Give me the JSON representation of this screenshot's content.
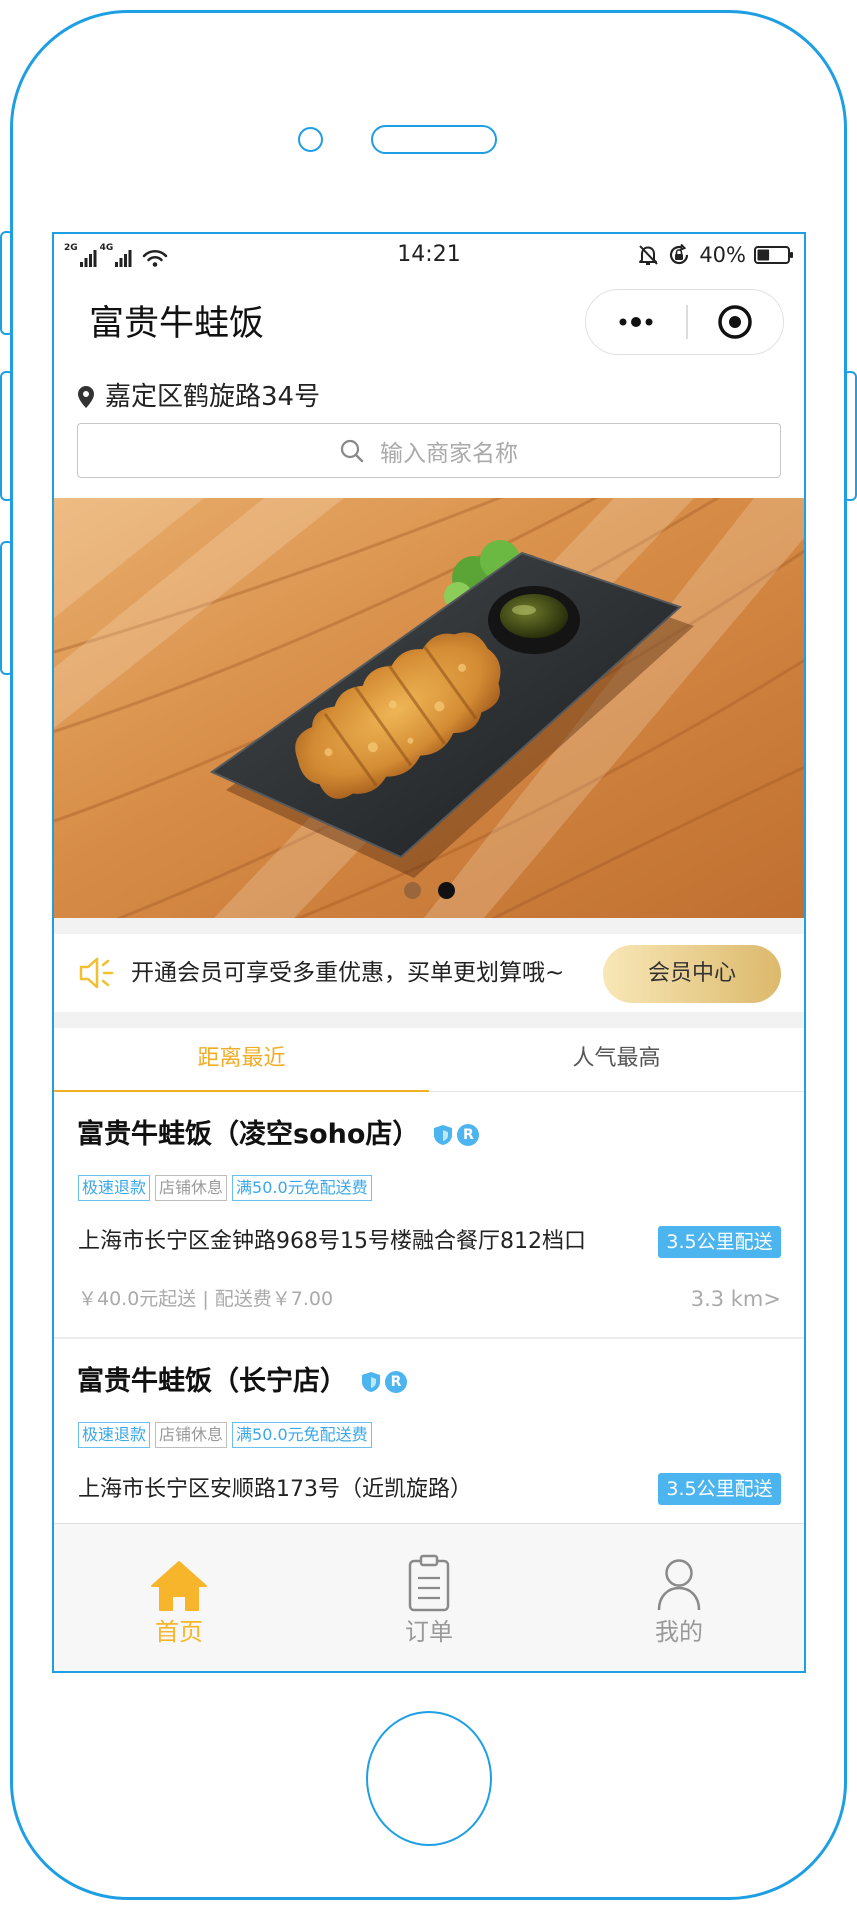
{
  "status_bar": {
    "network_1": "2G",
    "network_2": "4G",
    "time": "14:21",
    "battery_text": "40%",
    "battery_level": 0.4,
    "icons": [
      "signal-icon",
      "wifi-icon",
      "bell-off-icon",
      "rotation-lock-icon",
      "battery-icon"
    ]
  },
  "header": {
    "title": "富贵牛蛙饭",
    "capsule_icons": [
      "more-dots-icon",
      "target-icon"
    ]
  },
  "location": {
    "icon": "location-pin-icon",
    "text": "嘉定区鹤旋路34号"
  },
  "search": {
    "icon": "search-icon",
    "placeholder": "输入商家名称"
  },
  "banner": {
    "slide_count": 2,
    "active_slide": 2
  },
  "member": {
    "icon": "speaker-icon",
    "text": "开通会员可享受多重优惠，买单更划算哦~",
    "button": "会员中心"
  },
  "sort_tabs": [
    {
      "label": "距离最近",
      "active": true
    },
    {
      "label": "人气最高",
      "active": false
    }
  ],
  "stores": [
    {
      "name": "富贵牛蛙饭（凌空soho店）",
      "badges": [
        {
          "icon": "shield-icon"
        },
        {
          "icon": "registered-icon",
          "label": "R"
        }
      ],
      "tags": [
        {
          "label": "极速退款",
          "color": "#3aa8e8"
        },
        {
          "label": "店铺休息",
          "color": "#9a9a9a"
        },
        {
          "label": "满50.0元免配送费",
          "color": "#3aa8e8"
        }
      ],
      "address": "上海市长宁区金钟路968号15号楼融合餐厅812档口",
      "delivery_range": "3.5公里配送",
      "price_info": "￥40.0元起送 | 配送费￥7.00",
      "distance": "3.3 km>"
    },
    {
      "name": "富贵牛蛙饭（长宁店）",
      "badges": [
        {
          "icon": "shield-icon"
        },
        {
          "icon": "registered-icon",
          "label": "R"
        }
      ],
      "tags": [
        {
          "label": "极速退款",
          "color": "#3aa8e8"
        },
        {
          "label": "店铺休息",
          "color": "#9a9a9a"
        },
        {
          "label": "满50.0元免配送费",
          "color": "#3aa8e8"
        }
      ],
      "address": "上海市长宁区安顺路173号（近凯旋路）",
      "delivery_range": "3.5公里配送"
    }
  ],
  "tab_bar": [
    {
      "label": "首页",
      "icon": "home-icon",
      "active": true
    },
    {
      "label": "订单",
      "icon": "clipboard-icon",
      "active": false
    },
    {
      "label": "我的",
      "icon": "user-icon",
      "active": false
    }
  ],
  "colors": {
    "accent": "#f2b024",
    "badge_blue": "#4cb4ee",
    "frame_blue": "#1f9fe3",
    "member_gold": "#dcb96c"
  }
}
